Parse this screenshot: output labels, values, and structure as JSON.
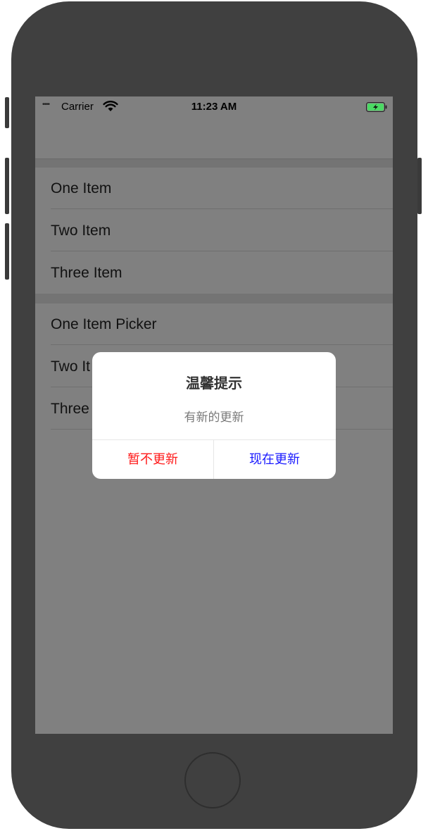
{
  "status_bar": {
    "signal_dots": "••••",
    "carrier": "Carrier",
    "time": "11:23 AM",
    "wifi_icon": "wifi-icon",
    "battery_icon": "battery-charging-icon",
    "battery_color": "#4cd964"
  },
  "list": {
    "section1": [
      {
        "label": "One Item"
      },
      {
        "label": "Two Item"
      },
      {
        "label": "Three Item"
      }
    ],
    "section2": [
      {
        "label": "One Item Picker"
      },
      {
        "label": "Two It"
      },
      {
        "label": "Three"
      }
    ]
  },
  "alert": {
    "title": "温馨提示",
    "message": "有新的更新",
    "cancel_label": "暂不更新",
    "confirm_label": "现在更新",
    "cancel_color": "#ff1a1a",
    "confirm_color": "#1a1aff"
  },
  "colors": {
    "phone_body": "#404040",
    "overlay_background": "#808080"
  }
}
